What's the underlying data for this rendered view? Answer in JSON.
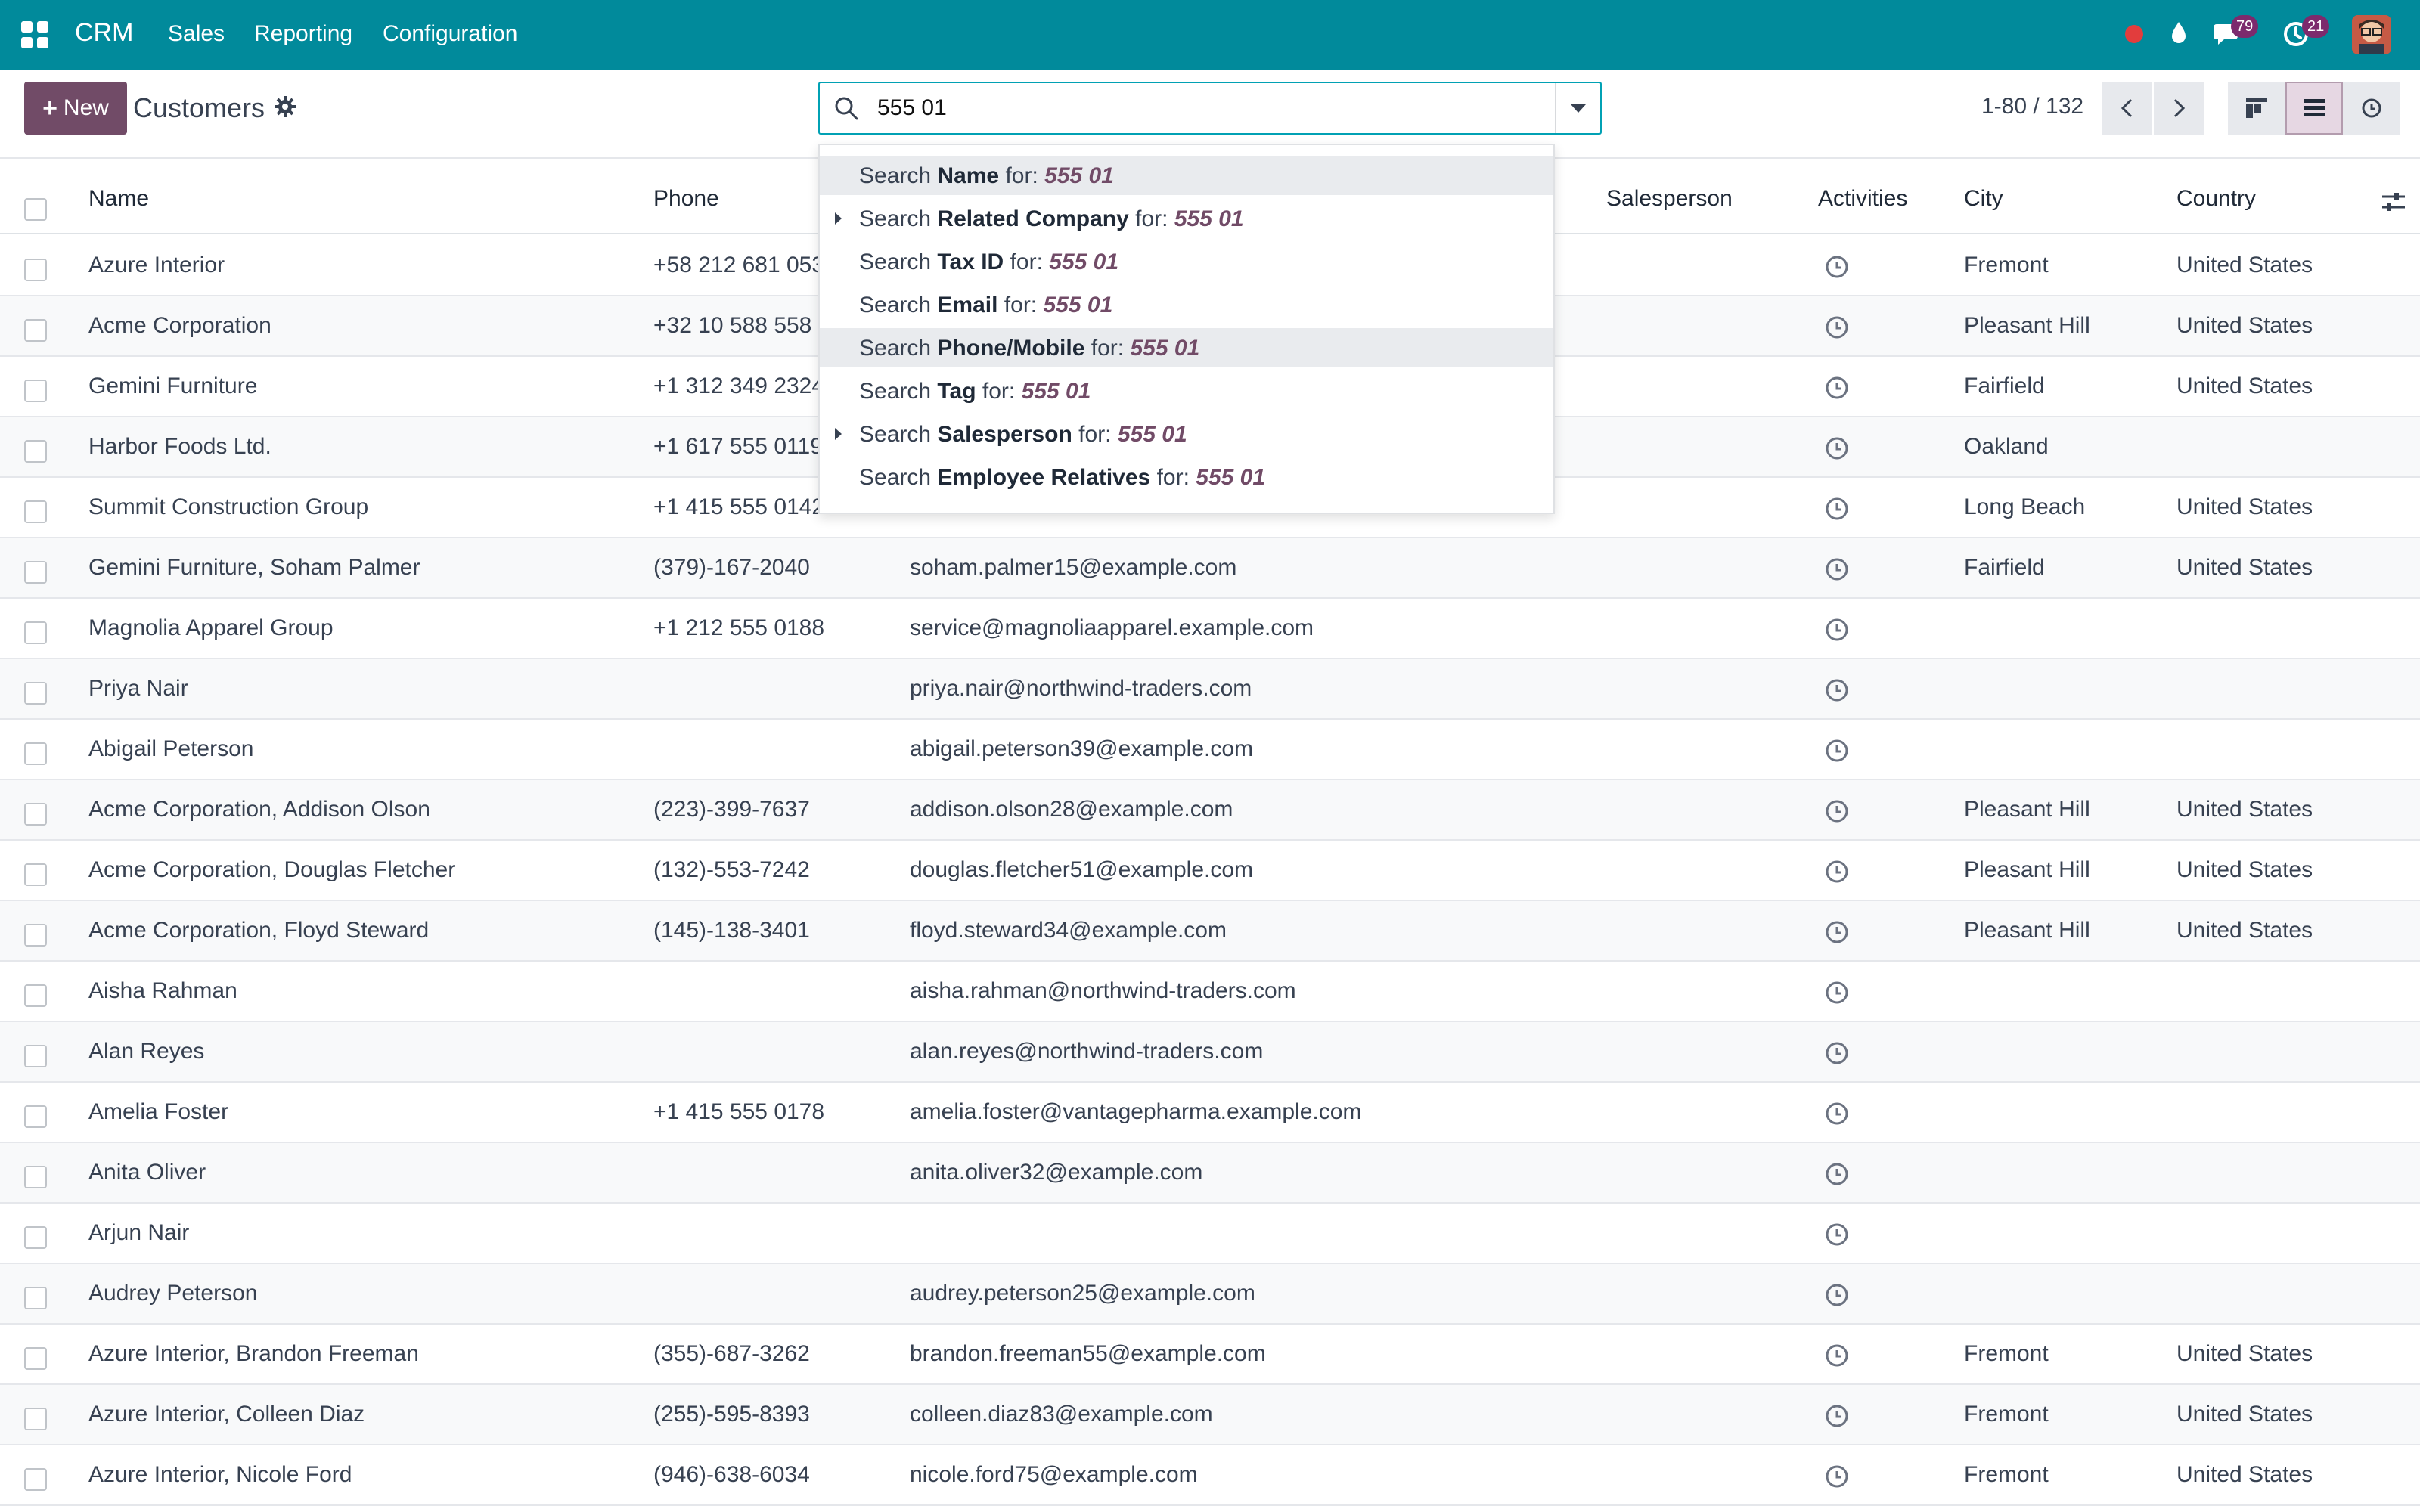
{
  "navbar": {
    "brand": "CRM",
    "menu": [
      "Sales",
      "Reporting",
      "Configuration"
    ],
    "messages_count": "79",
    "activities_count": "21"
  },
  "control_panel": {
    "new_label": "New",
    "title": "Customers",
    "search_value": "555 01",
    "pager": "1-80 / 132"
  },
  "columns": {
    "name": "Name",
    "phone": "Phone",
    "salesperson": "Salesperson",
    "activities": "Activities",
    "city": "City",
    "country": "Country"
  },
  "dropdown": {
    "prefix": "Search",
    "for": "for:",
    "value": "555 01",
    "items": [
      {
        "field": "Name",
        "expandable": false,
        "highlighted": true
      },
      {
        "field": "Related Company",
        "expandable": true,
        "highlighted": false
      },
      {
        "field": "Tax ID",
        "expandable": false,
        "highlighted": false
      },
      {
        "field": "Email",
        "expandable": false,
        "highlighted": false
      },
      {
        "field": "Phone/Mobile",
        "expandable": false,
        "highlighted": true
      },
      {
        "field": "Tag",
        "expandable": false,
        "highlighted": false
      },
      {
        "field": "Salesperson",
        "expandable": true,
        "highlighted": false
      },
      {
        "field": "Employee Relatives",
        "expandable": false,
        "highlighted": false
      }
    ]
  },
  "rows": [
    {
      "name": "Azure Interior",
      "phone": "+58 212 681 053",
      "email": "",
      "city": "Fremont",
      "country": "United States"
    },
    {
      "name": "Acme Corporation",
      "phone": "+32 10 588 558",
      "email": "",
      "city": "Pleasant Hill",
      "country": "United States"
    },
    {
      "name": "Gemini Furniture",
      "phone": "+1 312 349 2324",
      "email": "",
      "city": "Fairfield",
      "country": "United States"
    },
    {
      "name": "Harbor Foods Ltd.",
      "phone": "+1 617 555 0119",
      "email": "",
      "city": "Oakland",
      "country": ""
    },
    {
      "name": "Summit Construction Group",
      "phone": "+1 415 555 0142",
      "email": "",
      "city": "Long Beach",
      "country": "United States"
    },
    {
      "name": "Gemini Furniture, Soham Palmer",
      "phone": "(379)-167-2040",
      "email": "soham.palmer15@example.com",
      "city": "Fairfield",
      "country": "United States"
    },
    {
      "name": "Magnolia Apparel Group",
      "phone": "+1 212 555 0188",
      "email": "service@magnoliaapparel.example.com",
      "city": "",
      "country": ""
    },
    {
      "name": "Priya Nair",
      "phone": "",
      "email": "priya.nair@northwind-traders.com",
      "city": "",
      "country": ""
    },
    {
      "name": "Abigail Peterson",
      "phone": "",
      "email": "abigail.peterson39@example.com",
      "city": "",
      "country": ""
    },
    {
      "name": "Acme Corporation, Addison Olson",
      "phone": "(223)-399-7637",
      "email": "addison.olson28@example.com",
      "city": "Pleasant Hill",
      "country": "United States"
    },
    {
      "name": "Acme Corporation, Douglas Fletcher",
      "phone": "(132)-553-7242",
      "email": "douglas.fletcher51@example.com",
      "city": "Pleasant Hill",
      "country": "United States"
    },
    {
      "name": "Acme Corporation, Floyd Steward",
      "phone": "(145)-138-3401",
      "email": "floyd.steward34@example.com",
      "city": "Pleasant Hill",
      "country": "United States"
    },
    {
      "name": "Aisha Rahman",
      "phone": "",
      "email": "aisha.rahman@northwind-traders.com",
      "city": "",
      "country": ""
    },
    {
      "name": "Alan Reyes",
      "phone": "",
      "email": "alan.reyes@northwind-traders.com",
      "city": "",
      "country": ""
    },
    {
      "name": "Amelia Foster",
      "phone": "+1 415 555 0178",
      "email": "amelia.foster@vantagepharma.example.com",
      "city": "",
      "country": ""
    },
    {
      "name": "Anita Oliver",
      "phone": "",
      "email": "anita.oliver32@example.com",
      "city": "",
      "country": ""
    },
    {
      "name": "Arjun Nair",
      "phone": "",
      "email": "",
      "city": "",
      "country": ""
    },
    {
      "name": "Audrey Peterson",
      "phone": "",
      "email": "audrey.peterson25@example.com",
      "city": "",
      "country": ""
    },
    {
      "name": "Azure Interior, Brandon Freeman",
      "phone": "(355)-687-3262",
      "email": "brandon.freeman55@example.com",
      "city": "Fremont",
      "country": "United States"
    },
    {
      "name": "Azure Interior, Colleen Diaz",
      "phone": "(255)-595-8393",
      "email": "colleen.diaz83@example.com",
      "city": "Fremont",
      "country": "United States"
    },
    {
      "name": "Azure Interior, Nicole Ford",
      "phone": "(946)-638-6034",
      "email": "nicole.ford75@example.com",
      "city": "Fremont",
      "country": "United States"
    }
  ]
}
